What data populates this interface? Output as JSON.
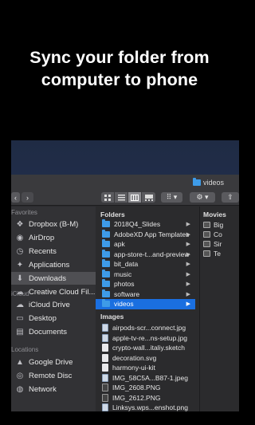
{
  "headline": {
    "line1": "Sync your folder from",
    "line2": "computer to phone"
  },
  "window": {
    "title": "videos",
    "nav_back": "‹",
    "nav_forward": "›",
    "view_icon": "⠿",
    "view_dropdown": "⠿ ▾",
    "action_button": "⚙ ▾"
  },
  "sidebar": {
    "favorites_header": "Favorites",
    "favorites": [
      {
        "label": "Dropbox (B-M)",
        "icon": "dropbox-icon",
        "glyph": "❖"
      },
      {
        "label": "AirDrop",
        "icon": "airdrop-icon",
        "glyph": "◉"
      },
      {
        "label": "Recents",
        "icon": "recents-icon",
        "glyph": "◷"
      },
      {
        "label": "Applications",
        "icon": "applications-icon",
        "glyph": "✦"
      },
      {
        "label": "Downloads",
        "icon": "downloads-icon",
        "glyph": "⬇"
      },
      {
        "label": "Creative Cloud Fil...",
        "icon": "creative-cloud-icon",
        "glyph": "☁"
      }
    ],
    "icloud_header": "iCloud",
    "icloud": [
      {
        "label": "iCloud Drive",
        "icon": "icloud-icon",
        "glyph": "☁"
      },
      {
        "label": "Desktop",
        "icon": "desktop-icon",
        "glyph": "▭"
      },
      {
        "label": "Documents",
        "icon": "documents-icon",
        "glyph": "▤"
      }
    ],
    "locations_header": "Locations",
    "locations": [
      {
        "label": "Google Drive",
        "icon": "google-drive-icon",
        "glyph": "▲"
      },
      {
        "label": "Remote Disc",
        "icon": "remote-disc-icon",
        "glyph": "◎"
      },
      {
        "label": "Network",
        "icon": "network-icon",
        "glyph": "◍"
      }
    ],
    "selected_index": 4
  },
  "folders_column": {
    "folders_header": "Folders",
    "folders": [
      "2018Q4_Slides",
      "AdobeXD App Templates",
      "apk",
      "app-store-t...and-preview",
      "bit_data",
      "music",
      "photos",
      "software",
      "videos"
    ],
    "selected_folder": "videos",
    "images_header": "Images",
    "images": [
      {
        "name": "airpods-scr...connect.jpg",
        "kind": "img"
      },
      {
        "name": "apple-tv-re...ns-setup.jpg",
        "kind": "img"
      },
      {
        "name": "crypto-wall...italiy.sketch",
        "kind": "file"
      },
      {
        "name": "decoration.svg",
        "kind": "file"
      },
      {
        "name": "harmony-ui-kit",
        "kind": "file"
      },
      {
        "name": "IMG_58C5A...B87-1.jpeg",
        "kind": "img"
      },
      {
        "name": "IMG_2608.PNG",
        "kind": "dark"
      },
      {
        "name": "IMG_2612.PNG",
        "kind": "dark"
      },
      {
        "name": "Linksys.wps...enshot.png",
        "kind": "img"
      }
    ]
  },
  "movies_column": {
    "header": "Movies",
    "items": [
      "Big",
      "Co",
      "Sir",
      "Te"
    ]
  }
}
